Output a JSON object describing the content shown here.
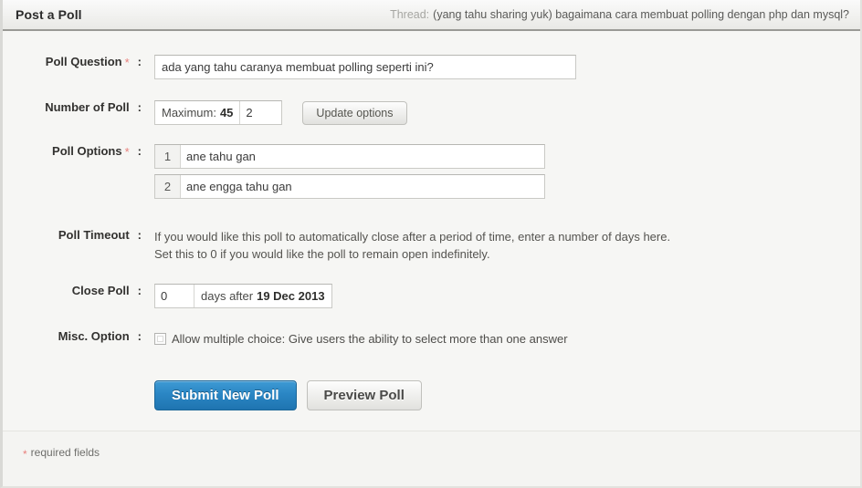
{
  "header": {
    "title": "Post a Poll",
    "thread_label": "Thread:",
    "thread_title": "(yang tahu sharing yuk) bagaimana cara membuat polling dengan php dan mysql?"
  },
  "form": {
    "colon": ":",
    "required_marker": "*",
    "poll_question": {
      "label": "Poll Question",
      "value": "ada yang tahu caranya membuat polling seperti ini?",
      "placeholder": ""
    },
    "number_of_poll": {
      "label": "Number of Poll",
      "prefix_text": "Maximum:",
      "maximum": "45",
      "value": "2",
      "update_button": "Update options"
    },
    "poll_options": {
      "label": "Poll Options",
      "options": [
        {
          "number": "1",
          "value": "ane tahu gan"
        },
        {
          "number": "2",
          "value": "ane engga tahu gan"
        }
      ]
    },
    "poll_timeout": {
      "label": "Poll Timeout",
      "line1": "If you would like this poll to automatically close after a period of time, enter a number of days here.",
      "line2": "Set this to 0 if you would like the poll to remain open indefinitely."
    },
    "close_poll": {
      "label": "Close Poll",
      "value": "0",
      "suffix_text": "days after",
      "date": "19 Dec 2013"
    },
    "misc_option": {
      "label": "Misc. Option",
      "checkbox_label": "Allow multiple choice: Give users the ability to select more than one answer",
      "checked": false
    },
    "actions": {
      "submit_label": "Submit New Poll",
      "preview_label": "Preview Poll"
    }
  },
  "footer": {
    "required_marker": "*",
    "note": "required fields"
  },
  "colors": {
    "primary_button": "#2a86c4",
    "required_asterisk": "#e8807c",
    "header_border": "#9a9a96",
    "page_background": "#f6f6f4"
  }
}
